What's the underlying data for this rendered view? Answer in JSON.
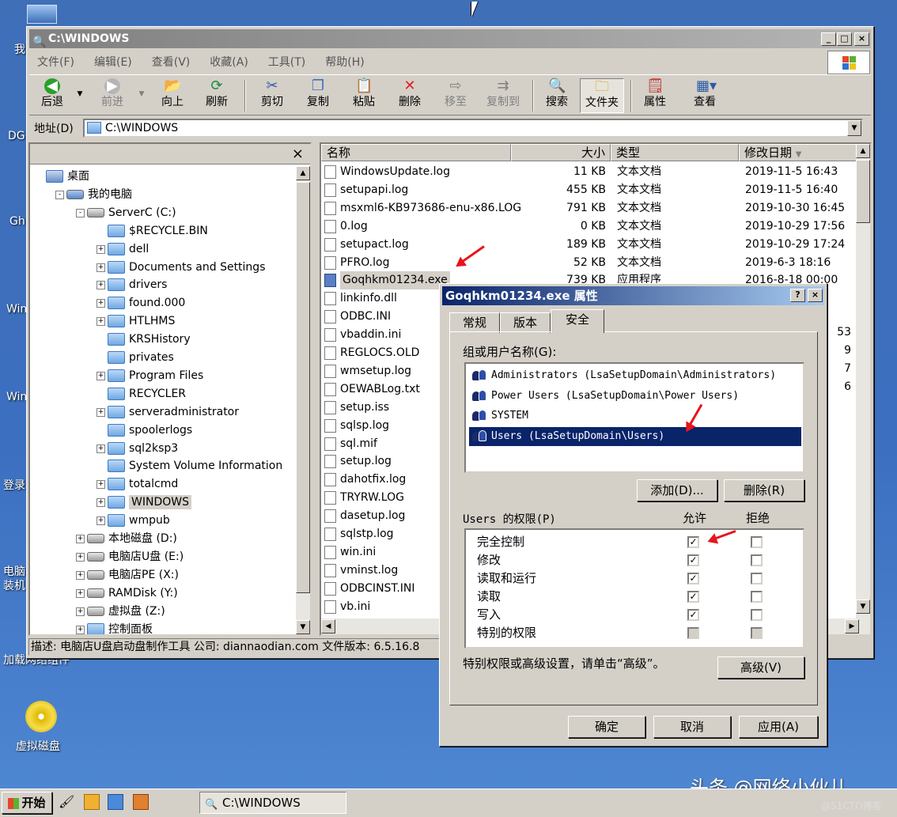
{
  "desktop": {
    "left_labels": [
      "我",
      "DG",
      "Gh",
      "Win",
      "Win",
      "登录",
      "电脑装机",
      "加载网络组件"
    ],
    "icon_label": "虚拟磁盘",
    "watermark": "头条 @网络小伙儿",
    "watermark2": "@51CTO博客"
  },
  "window": {
    "title": "C:\\WINDOWS",
    "menus": [
      "文件(F)",
      "编辑(E)",
      "查看(V)",
      "收藏(A)",
      "工具(T)",
      "帮助(H)"
    ],
    "toolbar": {
      "back": "后退",
      "forward": "前进",
      "up": "向上",
      "refresh": "刷新",
      "cut": "剪切",
      "copy": "复制",
      "paste": "粘贴",
      "delete": "删除",
      "move": "移至",
      "copyto": "复制到",
      "search": "搜索",
      "folders": "文件夹",
      "props": "属性",
      "view": "查看"
    },
    "address_label": "地址(D)",
    "address_value": "C:\\WINDOWS",
    "tree_close": "×",
    "tree": [
      {
        "label": "桌面",
        "indent": 0,
        "kind": "desktop"
      },
      {
        "label": "我的电脑",
        "indent": 1,
        "kind": "pc",
        "pm": "-"
      },
      {
        "label": "ServerC (C:)",
        "indent": 2,
        "kind": "drive",
        "pm": "-"
      },
      {
        "label": "$RECYCLE.BIN",
        "indent": 3,
        "kind": "folder"
      },
      {
        "label": "dell",
        "indent": 3,
        "kind": "folder",
        "pm": "+"
      },
      {
        "label": "Documents and Settings",
        "indent": 3,
        "kind": "folder",
        "pm": "+"
      },
      {
        "label": "drivers",
        "indent": 3,
        "kind": "folder",
        "pm": "+"
      },
      {
        "label": "found.000",
        "indent": 3,
        "kind": "folder",
        "pm": "+"
      },
      {
        "label": "HTLHMS",
        "indent": 3,
        "kind": "folder",
        "pm": "+"
      },
      {
        "label": "KRSHistory",
        "indent": 3,
        "kind": "folder"
      },
      {
        "label": "privates",
        "indent": 3,
        "kind": "folder"
      },
      {
        "label": "Program Files",
        "indent": 3,
        "kind": "folder",
        "pm": "+"
      },
      {
        "label": "RECYCLER",
        "indent": 3,
        "kind": "folder"
      },
      {
        "label": "serveradministrator",
        "indent": 3,
        "kind": "folder",
        "pm": "+"
      },
      {
        "label": "spoolerlogs",
        "indent": 3,
        "kind": "folder"
      },
      {
        "label": "sql2ksp3",
        "indent": 3,
        "kind": "folder",
        "pm": "+"
      },
      {
        "label": "System Volume Information",
        "indent": 3,
        "kind": "folder"
      },
      {
        "label": "totalcmd",
        "indent": 3,
        "kind": "folder",
        "pm": "+"
      },
      {
        "label": "WINDOWS",
        "indent": 3,
        "kind": "folder",
        "pm": "+",
        "selected": true
      },
      {
        "label": "wmpub",
        "indent": 3,
        "kind": "folder",
        "pm": "+"
      },
      {
        "label": "本地磁盘 (D:)",
        "indent": 2,
        "kind": "drive",
        "pm": "+"
      },
      {
        "label": "电脑店U盘 (E:)",
        "indent": 2,
        "kind": "drive",
        "pm": "+"
      },
      {
        "label": "电脑店PE (X:)",
        "indent": 2,
        "kind": "drive",
        "pm": "+"
      },
      {
        "label": "RAMDisk (Y:)",
        "indent": 2,
        "kind": "drive",
        "pm": "+"
      },
      {
        "label": "虚拟盘 (Z:)",
        "indent": 2,
        "kind": "drive",
        "pm": "+"
      },
      {
        "label": "控制面板",
        "indent": 2,
        "kind": "folder",
        "pm": "+"
      }
    ],
    "columns": {
      "name": "名称",
      "size": "大小",
      "type": "类型",
      "date": "修改日期"
    },
    "files": [
      {
        "name": "WindowsUpdate.log",
        "size": "11 KB",
        "type": "文本文档",
        "date": "2019-11-5 16:43"
      },
      {
        "name": "setupapi.log",
        "size": "455 KB",
        "type": "文本文档",
        "date": "2019-11-5 16:40"
      },
      {
        "name": "msxml6-KB973686-enu-x86.LOG",
        "size": "791 KB",
        "type": "文本文档",
        "date": "2019-10-30 16:45"
      },
      {
        "name": "0.log",
        "size": "0 KB",
        "type": "文本文档",
        "date": "2019-10-29 17:56"
      },
      {
        "name": "setupact.log",
        "size": "189 KB",
        "type": "文本文档",
        "date": "2019-10-29 17:24"
      },
      {
        "name": "PFRO.log",
        "size": "52 KB",
        "type": "文本文档",
        "date": "2019-6-3 18:16"
      },
      {
        "name": "Goqhkm01234.exe",
        "size": "739 KB",
        "type": "应用程序",
        "date": "2016-8-18 00:00",
        "selected": true
      },
      {
        "name": "linkinfo.dll",
        "size": "",
        "type": "",
        "date": ""
      },
      {
        "name": "ODBC.INI",
        "size": "",
        "type": "",
        "date": ""
      },
      {
        "name": "vbaddin.ini",
        "size": "",
        "type": "",
        "date": ""
      },
      {
        "name": "REGLOCS.OLD",
        "size": "",
        "type": "",
        "date": ""
      },
      {
        "name": "wmsetup.log",
        "size": "",
        "type": "",
        "date": ""
      },
      {
        "name": "OEWABLog.txt",
        "size": "",
        "type": "",
        "date": ""
      },
      {
        "name": "setup.iss",
        "size": "",
        "type": "",
        "date": ""
      },
      {
        "name": "sqlsp.log",
        "size": "",
        "type": "",
        "date": ""
      },
      {
        "name": "sql.mif",
        "size": "",
        "type": "",
        "date": ""
      },
      {
        "name": "setup.log",
        "size": "",
        "type": "",
        "date": ""
      },
      {
        "name": "dahotfix.log",
        "size": "",
        "type": "",
        "date": ""
      },
      {
        "name": "TRYRW.LOG",
        "size": "",
        "type": "",
        "date": ""
      },
      {
        "name": "dasetup.log",
        "size": "",
        "type": "",
        "date": ""
      },
      {
        "name": "sqlstp.log",
        "size": "",
        "type": "",
        "date": ""
      },
      {
        "name": "win.ini",
        "size": "",
        "type": "",
        "date": ""
      },
      {
        "name": "vminst.log",
        "size": "",
        "type": "",
        "date": ""
      },
      {
        "name": "ODBCINST.INI",
        "size": "",
        "type": "",
        "date": ""
      },
      {
        "name": "vb.ini",
        "size": "",
        "type": "",
        "date": ""
      }
    ],
    "peek_digits": [
      "53",
      "9",
      "7",
      "6"
    ],
    "status": "描述: 电脑店U盘启动盘制作工具 公司: diannaodian.com 文件版本: 6.5.16.8"
  },
  "dialog": {
    "title": "Goqhkm01234.exe 属性",
    "tabs": [
      "常规",
      "版本",
      "安全"
    ],
    "groups_label": "组或用户名称(G):",
    "users": [
      "Administrators (LsaSetupDomain\\Administrators)",
      "Power Users (LsaSetupDomain\\Power Users)",
      "SYSTEM",
      "Users (LsaSetupDomain\\Users)"
    ],
    "add_button": "添加(D)...",
    "remove_button": "删除(R)",
    "perm_label": "Users 的权限(P)",
    "allow": "允许",
    "deny": "拒绝",
    "permissions": [
      {
        "name": "完全控制",
        "allow": "checked",
        "deny": "empty"
      },
      {
        "name": "修改",
        "allow": "checked",
        "deny": "empty"
      },
      {
        "name": "读取和运行",
        "allow": "checked",
        "deny": "empty"
      },
      {
        "name": "读取",
        "allow": "checked",
        "deny": "empty"
      },
      {
        "name": "写入",
        "allow": "checked",
        "deny": "empty"
      },
      {
        "name": "特别的权限",
        "allow": "disabled",
        "deny": "disabled"
      }
    ],
    "advanced_hint": "特别权限或高级设置，请单击“高级”。",
    "advanced_button": "高级(V)",
    "ok": "确定",
    "cancel": "取消",
    "apply": "应用(A)"
  },
  "taskbar": {
    "start": "开始",
    "task": "C:\\WINDOWS"
  },
  "colors": {
    "accent": "#0a246a",
    "arrow": "#e8141c"
  }
}
